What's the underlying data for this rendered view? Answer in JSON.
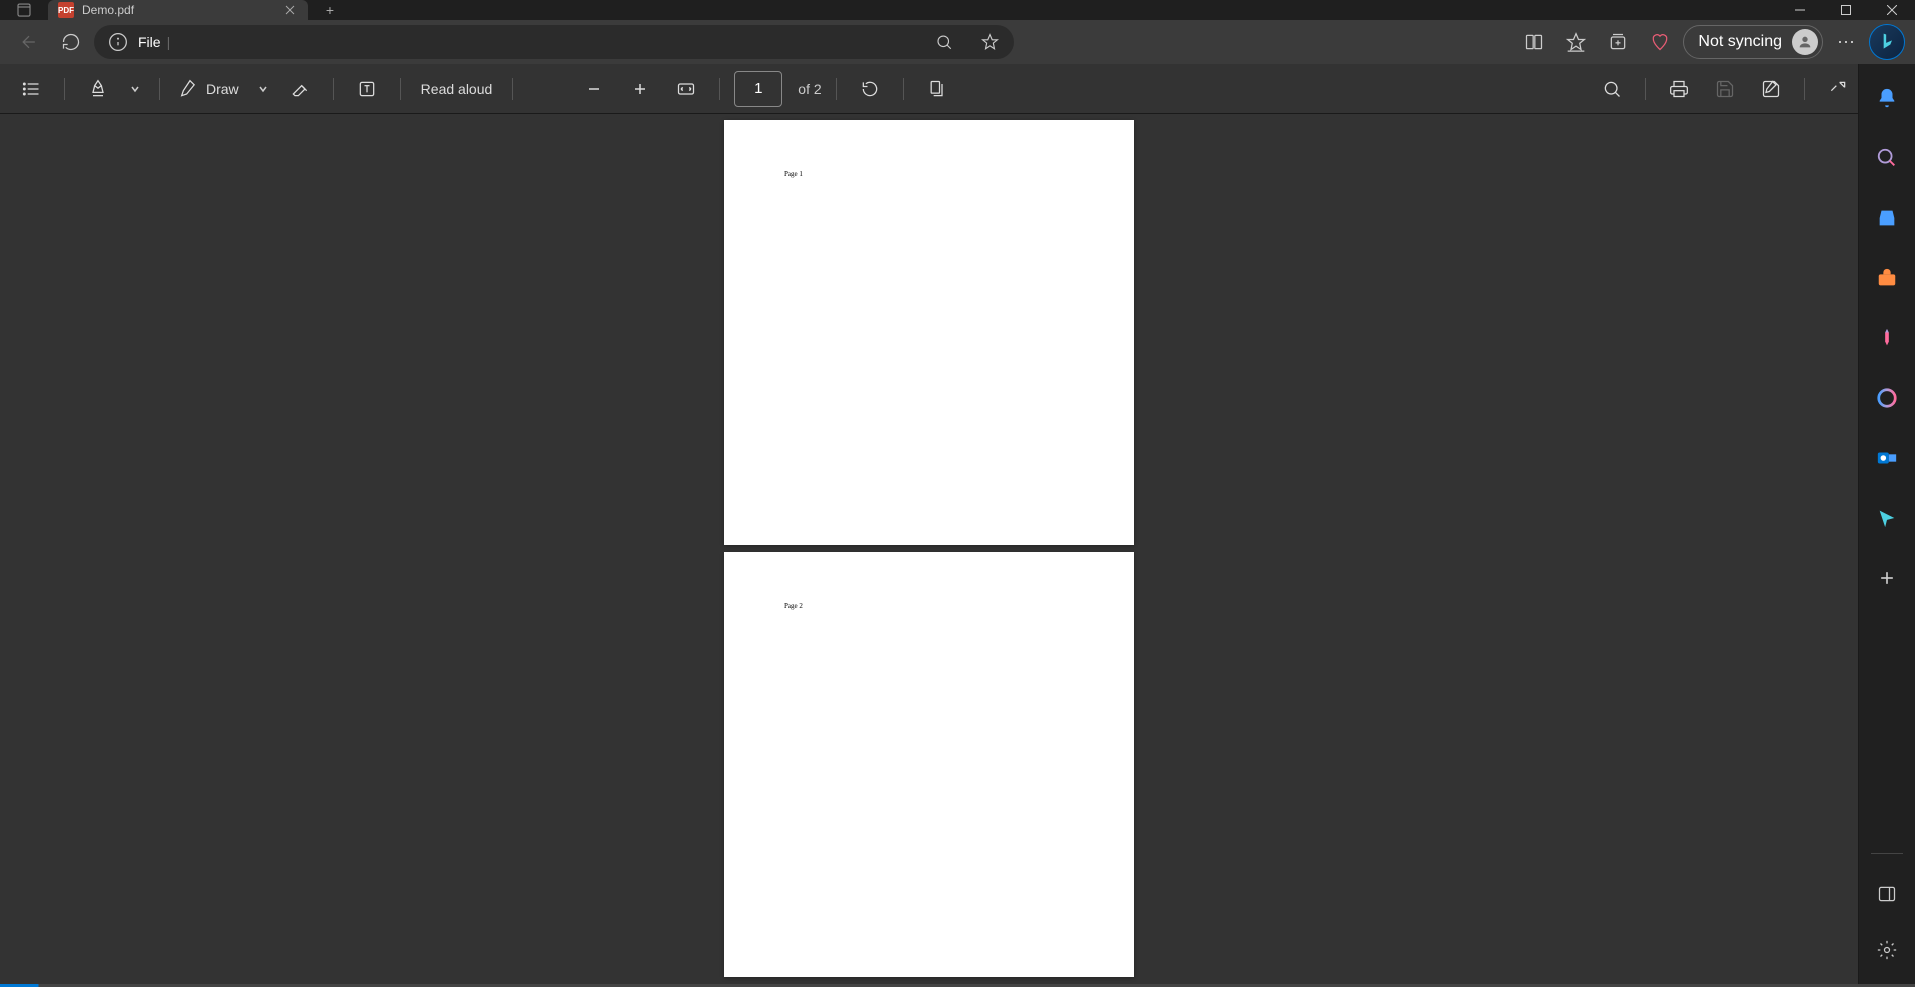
{
  "tab": {
    "title": "Demo.pdf",
    "icon_label": "PDF"
  },
  "address": {
    "scheme": "File"
  },
  "sync": {
    "label": "Not syncing"
  },
  "pdf_toolbar": {
    "draw_label": "Draw",
    "read_aloud_label": "Read aloud",
    "current_page": "1",
    "total_pages_label": "of 2"
  },
  "pages": [
    {
      "label": "Page 1"
    },
    {
      "label": "Page 2"
    }
  ]
}
